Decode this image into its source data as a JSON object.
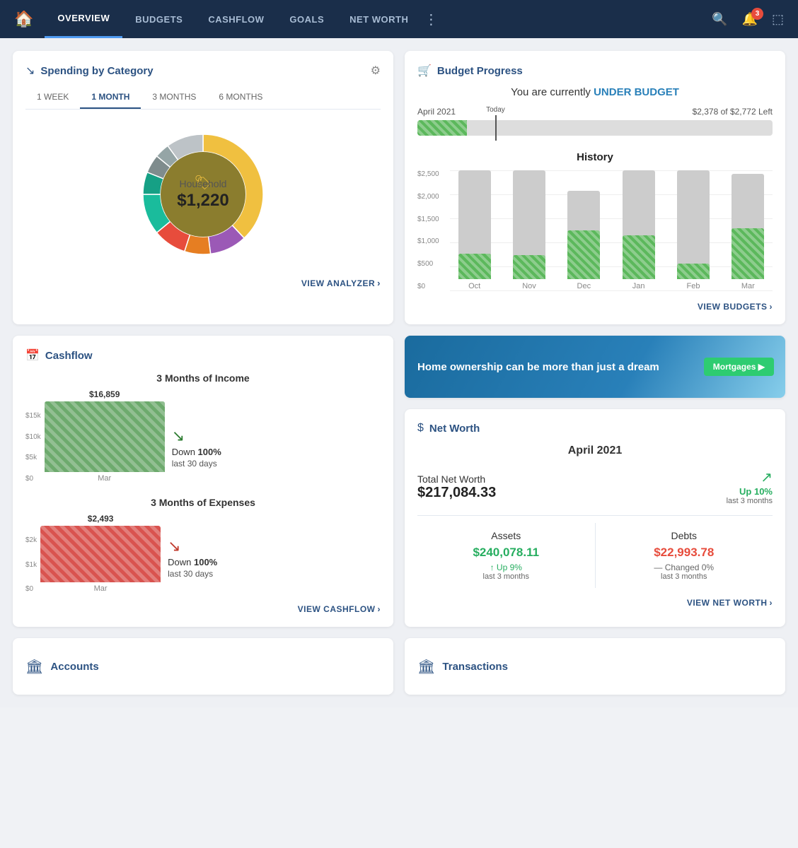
{
  "nav": {
    "items": [
      {
        "label": "OVERVIEW",
        "active": true
      },
      {
        "label": "BUDGETS",
        "active": false
      },
      {
        "label": "CASHFLOW",
        "active": false
      },
      {
        "label": "GOALS",
        "active": false
      },
      {
        "label": "NET WORTH",
        "active": false
      }
    ],
    "notification_count": "3"
  },
  "spending": {
    "title": "Spending by Category",
    "tabs": [
      "1 WEEK",
      "1 MONTH",
      "3 MONTHS",
      "6 MONTHS"
    ],
    "active_tab": "1 MONTH",
    "center_label": "Household",
    "center_value": "$1,220",
    "view_link": "VIEW ANALYZER"
  },
  "budget": {
    "title": "Budget Progress",
    "status_text": "You are currently ",
    "status_highlight": "UNDER BUDGET",
    "period": "April 2021",
    "amount_left": "$2,378 of $2,772 Left",
    "progress_pct": 14,
    "today_label": "Today",
    "history_title": "History",
    "bars": [
      {
        "month": "Oct",
        "total": 100,
        "spent": 23
      },
      {
        "month": "Nov",
        "total": 100,
        "spent": 22
      },
      {
        "month": "Dec",
        "total": 80,
        "spent": 55
      },
      {
        "month": "Jan",
        "total": 100,
        "spent": 40
      },
      {
        "month": "Feb",
        "total": 100,
        "spent": 14
      },
      {
        "month": "Mar",
        "total": 95,
        "spent": 48
      }
    ],
    "y_labels": [
      "$2,500",
      "$2,000",
      "$1,500",
      "$1,000",
      "$500",
      "$0"
    ],
    "view_link": "VIEW BUDGETS"
  },
  "cashflow": {
    "title": "Cashflow",
    "income_title": "3 Months of Income",
    "income_amount": "$16,859",
    "income_bar_month": "Mar",
    "income_down_text": "Down ",
    "income_down_pct": "100%",
    "income_down_sub": "last 30 days",
    "income_y_labels": [
      "$15k",
      "$10k",
      "$5k",
      "$0"
    ],
    "expense_title": "3 Months of Expenses",
    "expense_amount": "$2,493",
    "expense_bar_month": "Mar",
    "expense_down_text": "Down ",
    "expense_down_pct": "100%",
    "expense_down_sub": "last 30 days",
    "expense_y_labels": [
      "$2k",
      "$1k",
      "$0"
    ],
    "view_link": "VIEW CASHFLOW"
  },
  "ad": {
    "text": "Home ownership can be more than just a dream",
    "btn_label": "Mortgages ▶"
  },
  "net_worth": {
    "title": "Net Worth",
    "period": "April 2021",
    "total_label": "Total Net Worth",
    "total_value": "$217,084.33",
    "trend_icon": "↗",
    "trend_up": "Up 10%",
    "trend_sub": "last 3 months",
    "assets_label": "Assets",
    "assets_value": "$240,078.11",
    "assets_trend": "↑ Up 9%",
    "assets_sub": "last 3 months",
    "debts_label": "Debts",
    "debts_value": "$22,993.78",
    "debts_trend": "— Changed 0%",
    "debts_sub": "last 3 months",
    "view_link": "VIEW NET WORTH"
  },
  "accounts": {
    "title": "Accounts"
  },
  "transactions": {
    "title": "Transactions"
  },
  "donut_segments": [
    {
      "color": "#f0c040",
      "pct": 38
    },
    {
      "color": "#9b59b6",
      "pct": 10
    },
    {
      "color": "#e67e22",
      "pct": 7
    },
    {
      "color": "#e74c3c",
      "pct": 9
    },
    {
      "color": "#1abc9c",
      "pct": 11
    },
    {
      "color": "#16a085",
      "pct": 6
    },
    {
      "color": "#7f8c8d",
      "pct": 5
    },
    {
      "color": "#95a5a6",
      "pct": 4
    },
    {
      "color": "#bdc3c7",
      "pct": 10
    }
  ]
}
